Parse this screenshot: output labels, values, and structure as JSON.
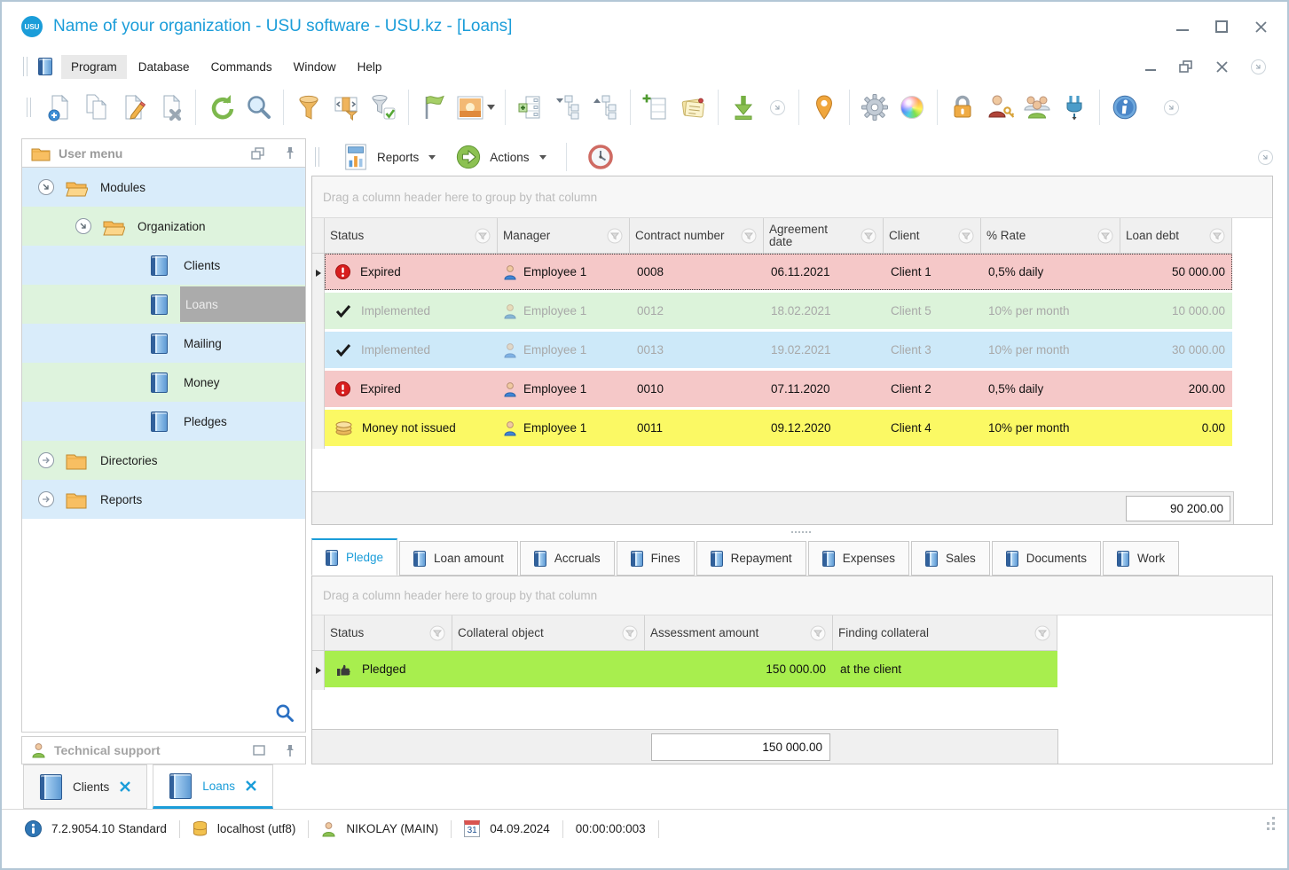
{
  "window": {
    "title": "Name of your organization - USU software - USU.kz - [Loans]",
    "logo_text": "USU"
  },
  "menu": {
    "items": [
      "Program",
      "Database",
      "Commands",
      "Window",
      "Help"
    ]
  },
  "toolbar": {
    "icons": [
      "new-record",
      "copy-record",
      "edit-record",
      "delete-record",
      "refresh",
      "search",
      "filter",
      "filter-columns",
      "filter-apply",
      "flag",
      "image",
      "image-dropdown",
      "row-details",
      "collapse-tree",
      "expand-tree",
      "add-column",
      "notes",
      "export",
      "overflow-chevron",
      "location-pin",
      "settings-gear",
      "color-scheme",
      "lock",
      "user-permissions",
      "users",
      "plugins",
      "info",
      "overflow-chevron"
    ]
  },
  "action_bar": {
    "reports_label": "Reports",
    "actions_label": "Actions"
  },
  "sidebar": {
    "title": "User menu",
    "support_title": "Technical support",
    "tree": [
      {
        "label": "Modules"
      },
      {
        "label": "Organization"
      },
      {
        "label": "Clients"
      },
      {
        "label": "Loans"
      },
      {
        "label": "Mailing"
      },
      {
        "label": "Money"
      },
      {
        "label": "Pledges"
      },
      {
        "label": "Directories"
      },
      {
        "label": "Reports"
      }
    ]
  },
  "loans_grid": {
    "group_hint": "Drag a column header here to group by that column",
    "columns": [
      "Status",
      "Manager",
      "Contract number",
      "Agreement date",
      "Client",
      "% Rate",
      "Loan debt"
    ],
    "rows": [
      {
        "status": "Expired",
        "manager": "Employee 1",
        "contract": "0008",
        "date": "06.11.2021",
        "client": "Client 1",
        "rate": "0,5% daily",
        "debt": "50 000.00"
      },
      {
        "status": "Implemented",
        "manager": "Employee 1",
        "contract": "0012",
        "date": "18.02.2021",
        "client": "Client 5",
        "rate": "10% per month",
        "debt": "10 000.00"
      },
      {
        "status": "Implemented",
        "manager": "Employee 1",
        "contract": "0013",
        "date": "19.02.2021",
        "client": "Client 3",
        "rate": "10% per month",
        "debt": "30 000.00"
      },
      {
        "status": "Expired",
        "manager": "Employee 1",
        "contract": "0010",
        "date": "07.11.2020",
        "client": "Client 2",
        "rate": "0,5% daily",
        "debt": "200.00"
      },
      {
        "status": "Money not issued",
        "manager": "Employee 1",
        "contract": "0011",
        "date": "09.12.2020",
        "client": "Client 4",
        "rate": "10% per month",
        "debt": "0.00"
      }
    ],
    "summary_total": "90 200.00"
  },
  "detail_tabs": {
    "active": "Pledge",
    "items": [
      "Pledge",
      "Loan amount",
      "Accruals",
      "Fines",
      "Repayment",
      "Expenses",
      "Sales",
      "Documents",
      "Work"
    ]
  },
  "pledge_grid": {
    "group_hint": "Drag a column header here to group by that column",
    "columns": [
      "Status",
      "Collateral object",
      "Assessment amount",
      "Finding collateral"
    ],
    "rows": [
      {
        "status": "Pledged",
        "object": "",
        "assessment": "150 000.00",
        "finding": "at the client"
      }
    ],
    "summary_total": "150 000.00"
  },
  "mdi_tabs": {
    "items": [
      {
        "label": "Clients"
      },
      {
        "label": "Loans"
      }
    ],
    "active": "Loans"
  },
  "statusbar": {
    "version": "7.2.9054.10 Standard",
    "database": "localhost (utf8)",
    "user": "NIKOLAY (MAIN)",
    "calendar_day": "31",
    "date": "04.09.2024",
    "timer": "00:00:00:003"
  }
}
